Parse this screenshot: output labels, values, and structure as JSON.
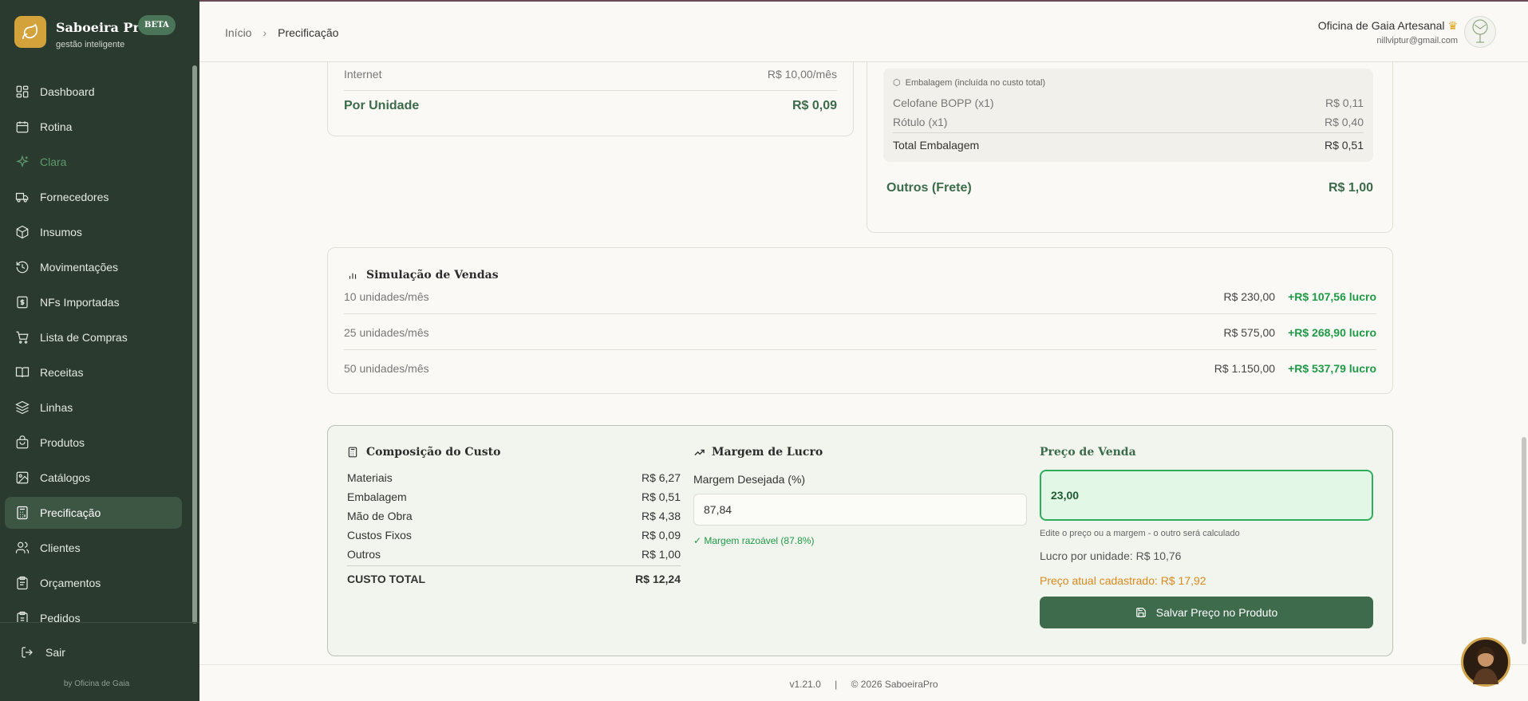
{
  "brand": {
    "name": "Saboeira Pro",
    "badge": "BETA",
    "tagline": "gestão inteligente"
  },
  "sidebar": {
    "items": [
      {
        "label": "Dashboard",
        "icon": "dashboard-icon"
      },
      {
        "label": "Rotina",
        "icon": "calendar-icon"
      },
      {
        "label": "Clara",
        "icon": "sparkles-icon"
      },
      {
        "label": "Fornecedores",
        "icon": "truck-icon"
      },
      {
        "label": "Insumos",
        "icon": "box-icon"
      },
      {
        "label": "Movimentações",
        "icon": "history-icon"
      },
      {
        "label": "NFs Importadas",
        "icon": "receipt-icon"
      },
      {
        "label": "Lista de Compras",
        "icon": "cart-icon"
      },
      {
        "label": "Receitas",
        "icon": "book-icon"
      },
      {
        "label": "Linhas",
        "icon": "layers-icon"
      },
      {
        "label": "Produtos",
        "icon": "bag-icon"
      },
      {
        "label": "Catálogos",
        "icon": "image-icon"
      },
      {
        "label": "Precificação",
        "icon": "calculator-icon"
      },
      {
        "label": "Clientes",
        "icon": "users-icon"
      },
      {
        "label": "Orçamentos",
        "icon": "clipboard-icon"
      },
      {
        "label": "Pedidos",
        "icon": "clipboard-list-icon"
      }
    ],
    "logout": "Sair",
    "credit": "by Oficina de Gaia"
  },
  "header": {
    "breadcrumb_home": "Início",
    "breadcrumb_current": "Precificação",
    "user_name": "Oficina de Gaia Artesanal",
    "user_email": "nillviptur@gmail.com"
  },
  "fixed_costs": {
    "internet_label": "Internet",
    "internet_value": "R$ 10,00/mês",
    "per_unit_label": "Por Unidade",
    "per_unit_value": "R$ 0,09"
  },
  "packaging": {
    "header": "Embalagem (incluída no custo total)",
    "items": [
      {
        "label": "Celofane BOPP (x1)",
        "value": "R$ 0,11"
      },
      {
        "label": "Rótulo (x1)",
        "value": "R$ 0,40"
      }
    ],
    "total_label": "Total Embalagem",
    "total_value": "R$ 0,51",
    "other_label": "Outros (Frete)",
    "other_value": "R$ 1,00"
  },
  "simulation": {
    "title": "Simulação de Vendas",
    "rows": [
      {
        "label": "10 unidades/mês",
        "price": "R$ 230,00",
        "profit": "+R$ 107,56 lucro"
      },
      {
        "label": "25 unidades/mês",
        "price": "R$ 575,00",
        "profit": "+R$ 268,90 lucro"
      },
      {
        "label": "50 unidades/mês",
        "price": "R$ 1.150,00",
        "profit": "+R$ 537,79 lucro"
      }
    ]
  },
  "composition": {
    "title": "Composição do Custo",
    "rows": [
      {
        "label": "Materiais",
        "value": "R$ 6,27"
      },
      {
        "label": "Embalagem",
        "value": "R$ 0,51"
      },
      {
        "label": "Mão de Obra",
        "value": "R$ 4,38"
      },
      {
        "label": "Custos Fixos",
        "value": "R$ 0,09"
      },
      {
        "label": "Outros",
        "value": "R$ 1,00"
      }
    ],
    "total_label": "CUSTO TOTAL",
    "total_value": "R$ 12,24"
  },
  "margin": {
    "title": "Margem de Lucro",
    "field_label": "Margem Desejada (%)",
    "value": "87,84",
    "status": "✓ Margem razoável (87.8%)"
  },
  "price": {
    "title": "Preço de Venda",
    "value": "23,00",
    "hint": "Edite o preço ou a margem - o outro será calculado",
    "profit_per_unit": "Lucro por unidade: R$ 10,76",
    "current_price": "Preço atual cadastrado: R$ 17,92",
    "save_label": "Salvar Preço no Produto"
  },
  "footer": {
    "version": "v1.21.0",
    "separator": "|",
    "copyright": "© 2026 SaboeiraPro"
  },
  "colors": {
    "sidebar": "#2a3a2e",
    "accent": "#3d6b4c",
    "profit": "#1f9a46",
    "warning": "#d98a1c"
  }
}
